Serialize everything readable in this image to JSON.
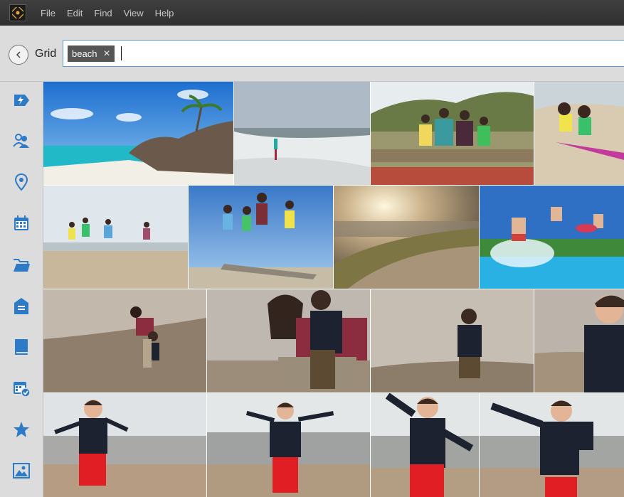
{
  "menu": {
    "items": [
      "File",
      "Edit",
      "Find",
      "View",
      "Help"
    ]
  },
  "header": {
    "view_label": "Grid"
  },
  "search": {
    "tag_label": "beach",
    "value": ""
  },
  "sidebar": {
    "items": [
      {
        "name": "instant-fix",
        "icon": "lightning-icon"
      },
      {
        "name": "people",
        "icon": "people-icon"
      },
      {
        "name": "places",
        "icon": "location-pin-icon"
      },
      {
        "name": "date",
        "icon": "calendar-icon"
      },
      {
        "name": "folders",
        "icon": "folder-icon"
      },
      {
        "name": "keywords",
        "icon": "tag-icon"
      },
      {
        "name": "albums",
        "icon": "album-icon"
      },
      {
        "name": "events",
        "icon": "events-icon"
      },
      {
        "name": "ratings",
        "icon": "star-icon"
      },
      {
        "name": "media-types",
        "icon": "image-icon"
      }
    ]
  },
  "photos": [
    {
      "id": "tropical-beach-rocks"
    },
    {
      "id": "girl-waves"
    },
    {
      "id": "family-on-log"
    },
    {
      "id": "girls-sledding-dunes"
    },
    {
      "id": "kids-running-beach"
    },
    {
      "id": "kids-jumping"
    },
    {
      "id": "sunset-dunes"
    },
    {
      "id": "kids-jumping-pool"
    },
    {
      "id": "woman-child-water"
    },
    {
      "id": "woman-smiling-child"
    },
    {
      "id": "boy-walking-water"
    },
    {
      "id": "boy-closeup"
    },
    {
      "id": "boy-arms-out-1"
    },
    {
      "id": "boy-arms-out-2"
    },
    {
      "id": "boy-arms-out-3"
    },
    {
      "id": "boy-arms-out-4"
    }
  ]
}
